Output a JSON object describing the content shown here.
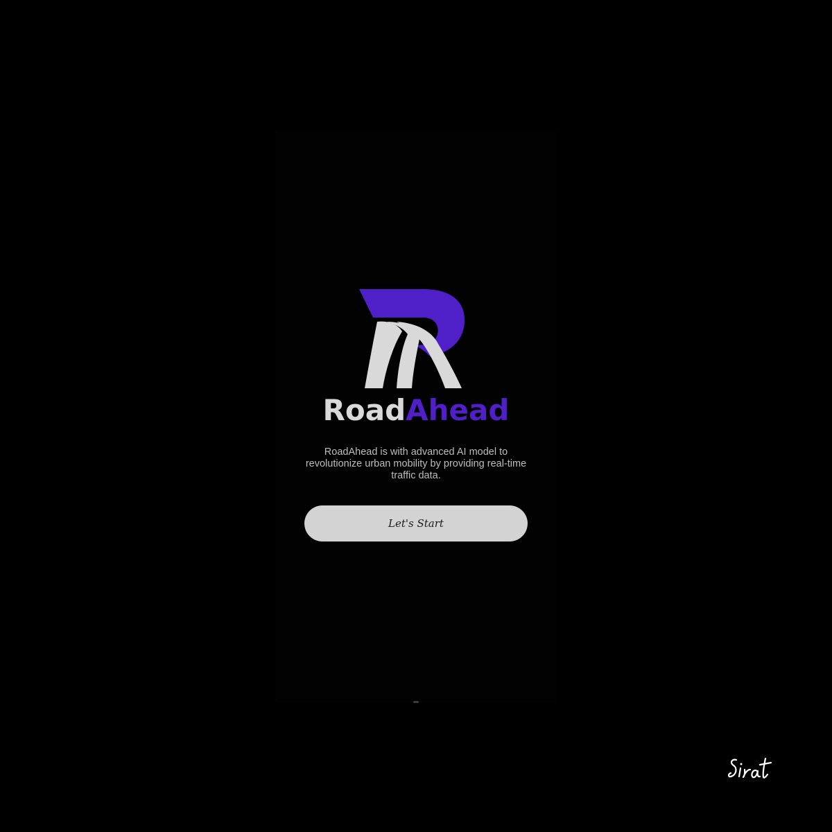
{
  "brand": {
    "name_part1": "Road",
    "name_part2": "Ahead",
    "logo_icon": "road-r-logo-icon",
    "primary_color": "#4f1fc7",
    "secondary_color": "#d9d9d9"
  },
  "intro": {
    "description": "RoadAhead is with advanced AI model to revolutionize urban mobility by providing real-time traffic data."
  },
  "actions": {
    "start_label": "Let's Start"
  },
  "watermark": {
    "text": "Sirat"
  }
}
